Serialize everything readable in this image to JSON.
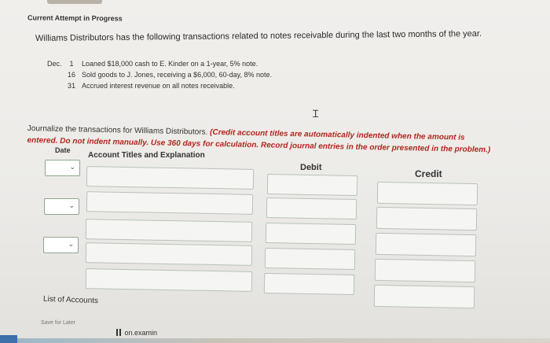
{
  "header": {
    "attempt_label": "Current Attempt in Progress"
  },
  "problem": {
    "intro": "Williams Distributors has the following transactions related to notes receivable during the last two months of the year.",
    "transactions": [
      {
        "month": "Dec.",
        "day": "1",
        "text": "Loaned $18,000 cash to E. Kinder on a 1-year, 5% note."
      },
      {
        "month": "",
        "day": "16",
        "text": "Sold goods to J. Jones, receiving a $6,000, 60-day, 8% note."
      },
      {
        "month": "",
        "day": "31",
        "text": "Accrued interest revenue on all notes receivable."
      }
    ]
  },
  "instructions": {
    "lead": "Journalize the transactions for Williams Distributors.",
    "note_part1": "(Credit account titles are automatically indented when the amount is entered. Do",
    "note_part2": "not indent manually. Use 360 days for calculation. Record journal entries in the order presented in the problem.)"
  },
  "table": {
    "col_date": "Date",
    "col_account": "Account Titles and Explanation",
    "col_debit": "Debit",
    "col_credit": "Credit"
  },
  "icons": {
    "chevron": "chevron-down-icon",
    "cursor": "text-cursor-icon"
  },
  "footer": {
    "list_of_accounts": "List of Accounts",
    "save_for_later": "Save for Later",
    "taskbar_text": "on.examin"
  },
  "colors": {
    "note_red": "#b3261e",
    "input_border": "#b9c2b9",
    "select_border": "#8fa58f"
  }
}
